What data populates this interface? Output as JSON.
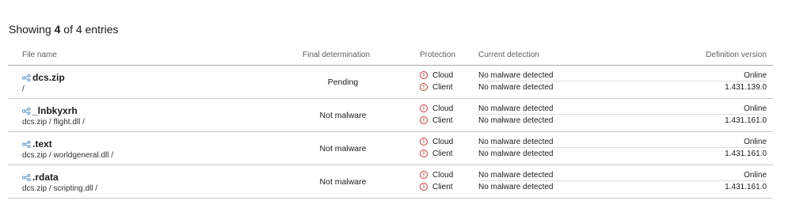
{
  "summary": {
    "prefix": "Showing ",
    "shown": "4",
    "suffix": " of 4 entries"
  },
  "headers": {
    "file_name": "File name",
    "final_determination": "Final determination",
    "protection": "Protection",
    "current_detection": "Current detection",
    "definition_version": "Definition version"
  },
  "rows": [
    {
      "name": "dcs.zip",
      "path": "/",
      "final": "Pending",
      "protection": [
        "Cloud",
        "Client"
      ],
      "detection": [
        "No malware detected",
        "No malware detected"
      ],
      "version": [
        "Online",
        "1.431.139.0"
      ]
    },
    {
      "name": "_lnbkyxrh",
      "path": "dcs.zip / flight.dll /",
      "final": "Not malware",
      "protection": [
        "Cloud",
        "Client"
      ],
      "detection": [
        "No malware detected",
        "No malware detected"
      ],
      "version": [
        "Online",
        "1.431.161.0"
      ]
    },
    {
      "name": ".text",
      "path": "dcs.zip / worldgeneral.dll /",
      "final": "Not malware",
      "protection": [
        "Cloud",
        "Client"
      ],
      "detection": [
        "No malware detected",
        "No malware detected"
      ],
      "version": [
        "Online",
        "1.431.161.0"
      ]
    },
    {
      "name": ".rdata",
      "path": "dcs.zip / scripting.dll /",
      "final": "Not malware",
      "protection": [
        "Cloud",
        "Client"
      ],
      "detection": [
        "No malware detected",
        "No malware detected"
      ],
      "version": [
        "Online",
        "1.431.161.0"
      ]
    }
  ],
  "icons": {
    "file": "share-nodes-icon",
    "protection": "warning-circle-icon"
  },
  "colors": {
    "warning": "#d13438",
    "header_text": "#605e5c",
    "row_border": "#c8c8c8"
  }
}
